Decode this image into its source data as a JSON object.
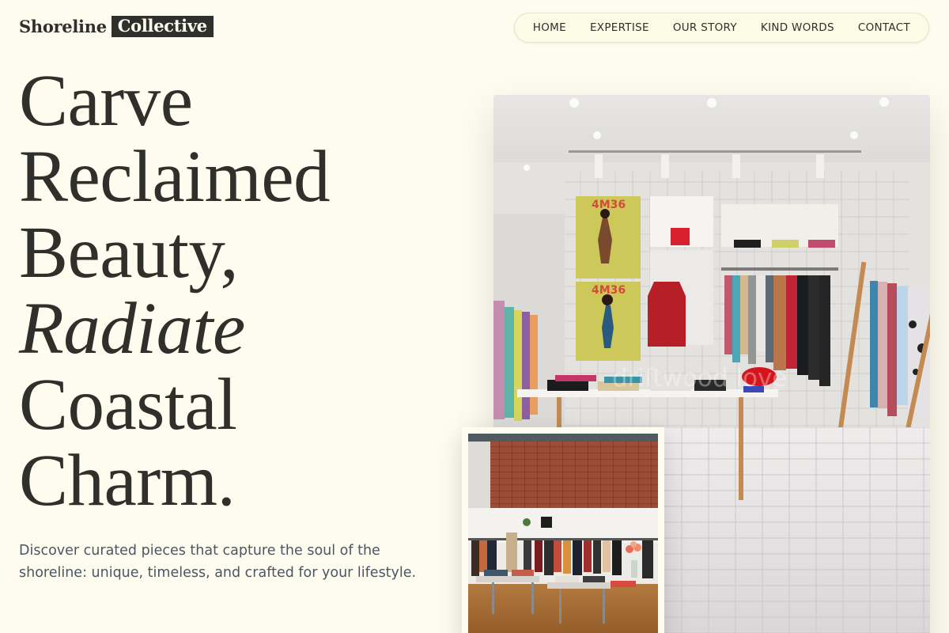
{
  "brand": {
    "name_part1": "Shoreline",
    "name_part2": "Collective"
  },
  "nav": {
    "items": [
      {
        "label": "HOME"
      },
      {
        "label": "EXPERTISE"
      },
      {
        "label": "OUR STORY"
      },
      {
        "label": "KIND WORDS"
      },
      {
        "label": "CONTACT"
      }
    ]
  },
  "hero": {
    "headline_lines": [
      "Carve",
      "Reclaimed",
      "Beauty,",
      "Radiate",
      "Coastal",
      "Charm."
    ],
    "italic_line_index": 3,
    "subcopy": "Discover curated pieces that capture the soul of the shoreline: unique, timeless, and crafted for your lifestyle."
  },
  "images": {
    "main": {
      "watermark": "driftwood love",
      "poster_label_1": "4M36",
      "poster_label_2": "4M36"
    }
  },
  "colors": {
    "background": "#fdfcee",
    "ink": "#2f2f2c",
    "subcopy": "#4c5563",
    "nav_border": "#e6e5cf"
  }
}
